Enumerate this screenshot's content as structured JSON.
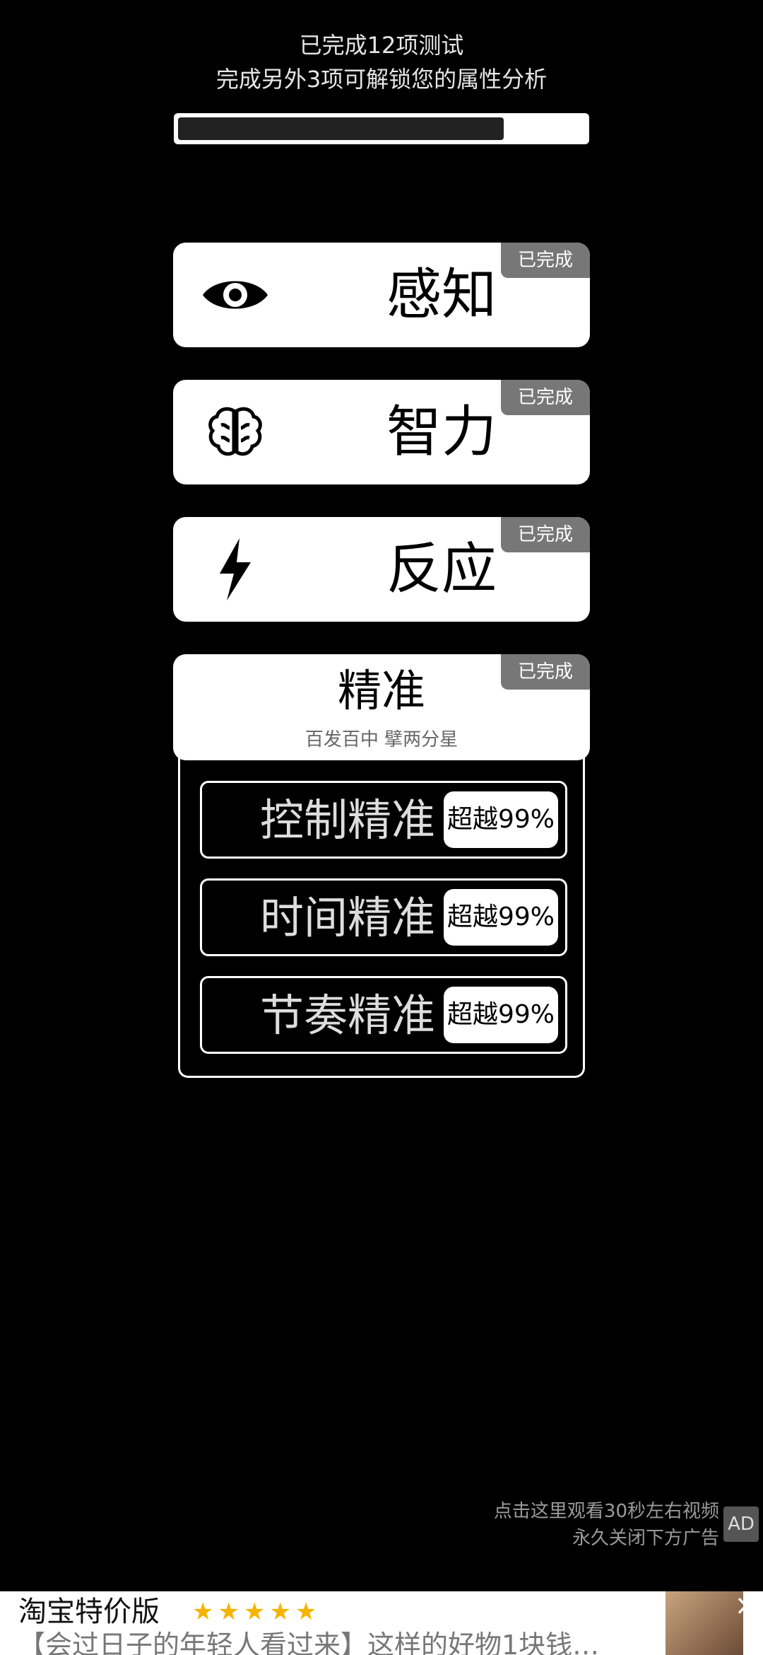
{
  "header": {
    "completed_text": "已完成12项测试",
    "unlock_text": "完成另外3项可解锁您的属性分析"
  },
  "progress": {
    "value": 12,
    "total": 15
  },
  "cards": [
    {
      "id": "perception",
      "title": "感知",
      "badge": "已完成",
      "icon": "eye-icon"
    },
    {
      "id": "intelligence",
      "title": "智力",
      "badge": "已完成",
      "icon": "brain-icon"
    },
    {
      "id": "reaction",
      "title": "反应",
      "badge": "已完成",
      "icon": "lightning-icon"
    },
    {
      "id": "accuracy",
      "title": "精准",
      "badge": "已完成",
      "subtitle": "百发百中 擘两分星"
    }
  ],
  "accuracy_details": [
    {
      "label": "控制精准",
      "result": "超越99%"
    },
    {
      "label": "时间精准",
      "result": "超越99%"
    },
    {
      "label": "节奏精准",
      "result": "超越99%"
    }
  ],
  "ad_hint": {
    "line1": "点击这里观看30秒左右视频",
    "line2": "永久关闭下方广告",
    "logo": "AD"
  },
  "banner": {
    "app_name": "淘宝特价版",
    "stars": "★★★★★",
    "slogan": "【会过日子的年轻人看过来】这样的好物1块钱…",
    "close": "×"
  },
  "colors": {
    "background": "#000000",
    "card": "#ffffff",
    "badge": "#777777",
    "star": "#f5b400"
  }
}
